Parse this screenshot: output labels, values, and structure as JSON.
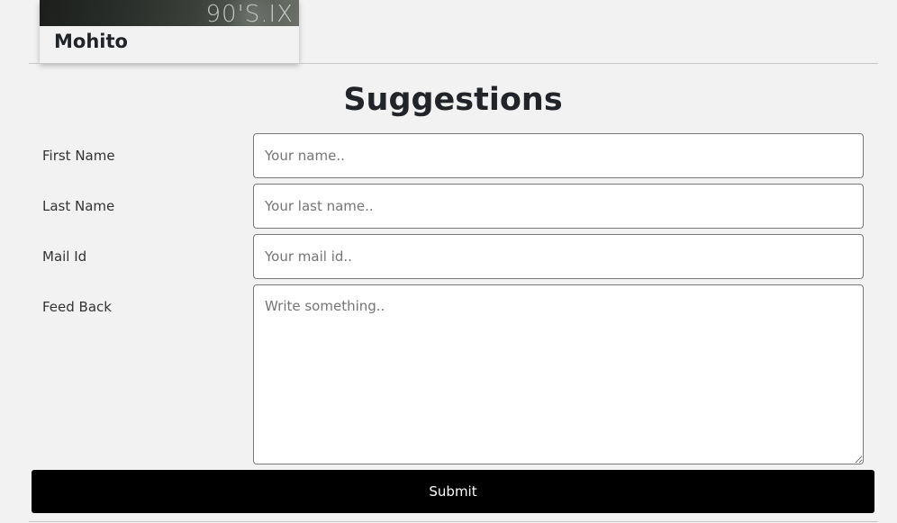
{
  "card": {
    "image_text": "90'S.IX",
    "title": "Mohito"
  },
  "form": {
    "heading": "Suggestions",
    "first_name": {
      "label": "First Name",
      "placeholder": "Your name..",
      "value": ""
    },
    "last_name": {
      "label": "Last Name",
      "placeholder": "Your last name..",
      "value": ""
    },
    "mail_id": {
      "label": "Mail Id",
      "placeholder": "Your mail id..",
      "value": ""
    },
    "feedback": {
      "label": "Feed Back",
      "placeholder": "Write something..",
      "value": ""
    },
    "submit_label": "Submit"
  },
  "colors": {
    "background": "#f2f2f2",
    "button": "#000000",
    "button_text": "#ffffff"
  }
}
